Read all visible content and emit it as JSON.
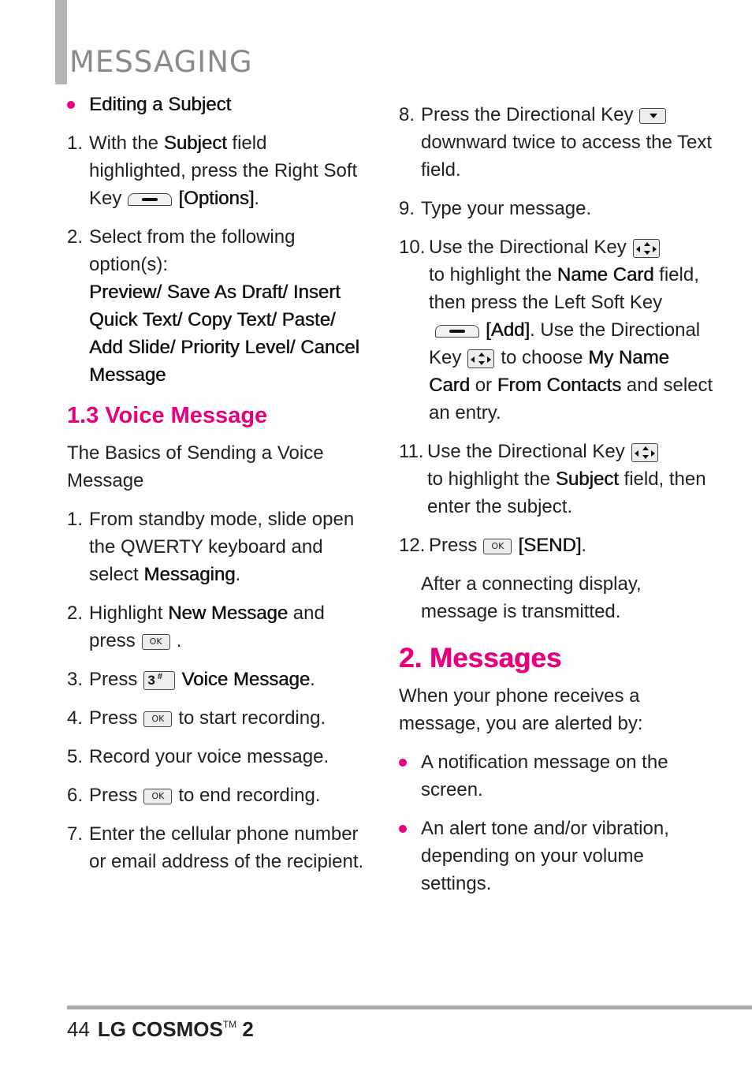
{
  "header": {
    "title": "MESSAGING",
    "accent_color": "#e6007e",
    "bar_color": "#b5b5b6"
  },
  "left": {
    "editing_bullet": "Editing a Subject",
    "edit_steps": [
      {
        "num": "1.",
        "pre": "With the ",
        "bold1": "Subject",
        "mid": " field highlighted, press the Right Soft Key",
        "key": "right-soft-key",
        "bold2": "[Options]",
        "post": "."
      },
      {
        "num": "2.",
        "pre": "Select from the following option(s):",
        "bold_options": "Preview/ Save As Draft/ Insert Quick Text/ Copy Text/ Paste/ Add Slide/ Priority Level/ Cancel Message"
      }
    ],
    "voice_heading": "1.3 Voice Message",
    "voice_intro": "The Basics of Sending a Voice Message",
    "voice_steps": [
      {
        "num": "1.",
        "pre": "From standby mode, slide open the QWERTY keyboard and select ",
        "bold": "Messaging",
        "post": "."
      },
      {
        "num": "2.",
        "pre": "Highlight ",
        "bold": "New Message",
        "post": " and press",
        "key_label": "OK",
        "tail": "."
      },
      {
        "num": "3.",
        "pre": "Press",
        "key_label": "3",
        "key_sup": "#",
        "bold": "Voice Message",
        "post": "."
      },
      {
        "num": "4.",
        "pre": "Press",
        "key_label": "OK",
        "post": "to start recording."
      },
      {
        "num": "5.",
        "text": "Record your voice message."
      },
      {
        "num": "6.",
        "pre": "Press",
        "key_label": "OK",
        "post": "to end recording."
      },
      {
        "num": "7.",
        "text": "Enter the cellular phone number or email address of the recipient."
      }
    ]
  },
  "right": {
    "steps": [
      {
        "num": "8.",
        "pre": "Press the Directional Key",
        "post": "downward twice to access the Text field."
      },
      {
        "num": "9.",
        "text": "Type your message."
      },
      {
        "num": "10.",
        "pre": "Use the Directional Key",
        "mid1": "to highlight the ",
        "bold1": "Name Card",
        "mid2": " field, then press the Left Soft Key",
        "bold2": "[Add]",
        "mid3": ". Use the Directional Key",
        "mid4": "to choose ",
        "bold3": "My Name Card",
        "mid5": " or ",
        "bold4": "From Contacts",
        "post": " and select an entry."
      },
      {
        "num": "11.",
        "pre": "Use the Directional Key",
        "mid1": "to highlight the ",
        "bold1": "Subject",
        "post": " field, then enter the subject."
      },
      {
        "num": "12.",
        "pre": "Press",
        "key_label": "OK",
        "bold": "[SEND]",
        "post": "."
      }
    ],
    "after_send": "After a connecting display, message is transmitted.",
    "messages_heading": "2. Messages",
    "messages_intro": "When your phone receives a message, you are alerted by:",
    "alerts": [
      "A notification message on the screen.",
      "An alert tone and/or vibration, depending on your volume settings."
    ]
  },
  "footer": {
    "page_number": "44",
    "brand": "LG COSMOS",
    "tm": "TM",
    "model": "2"
  }
}
